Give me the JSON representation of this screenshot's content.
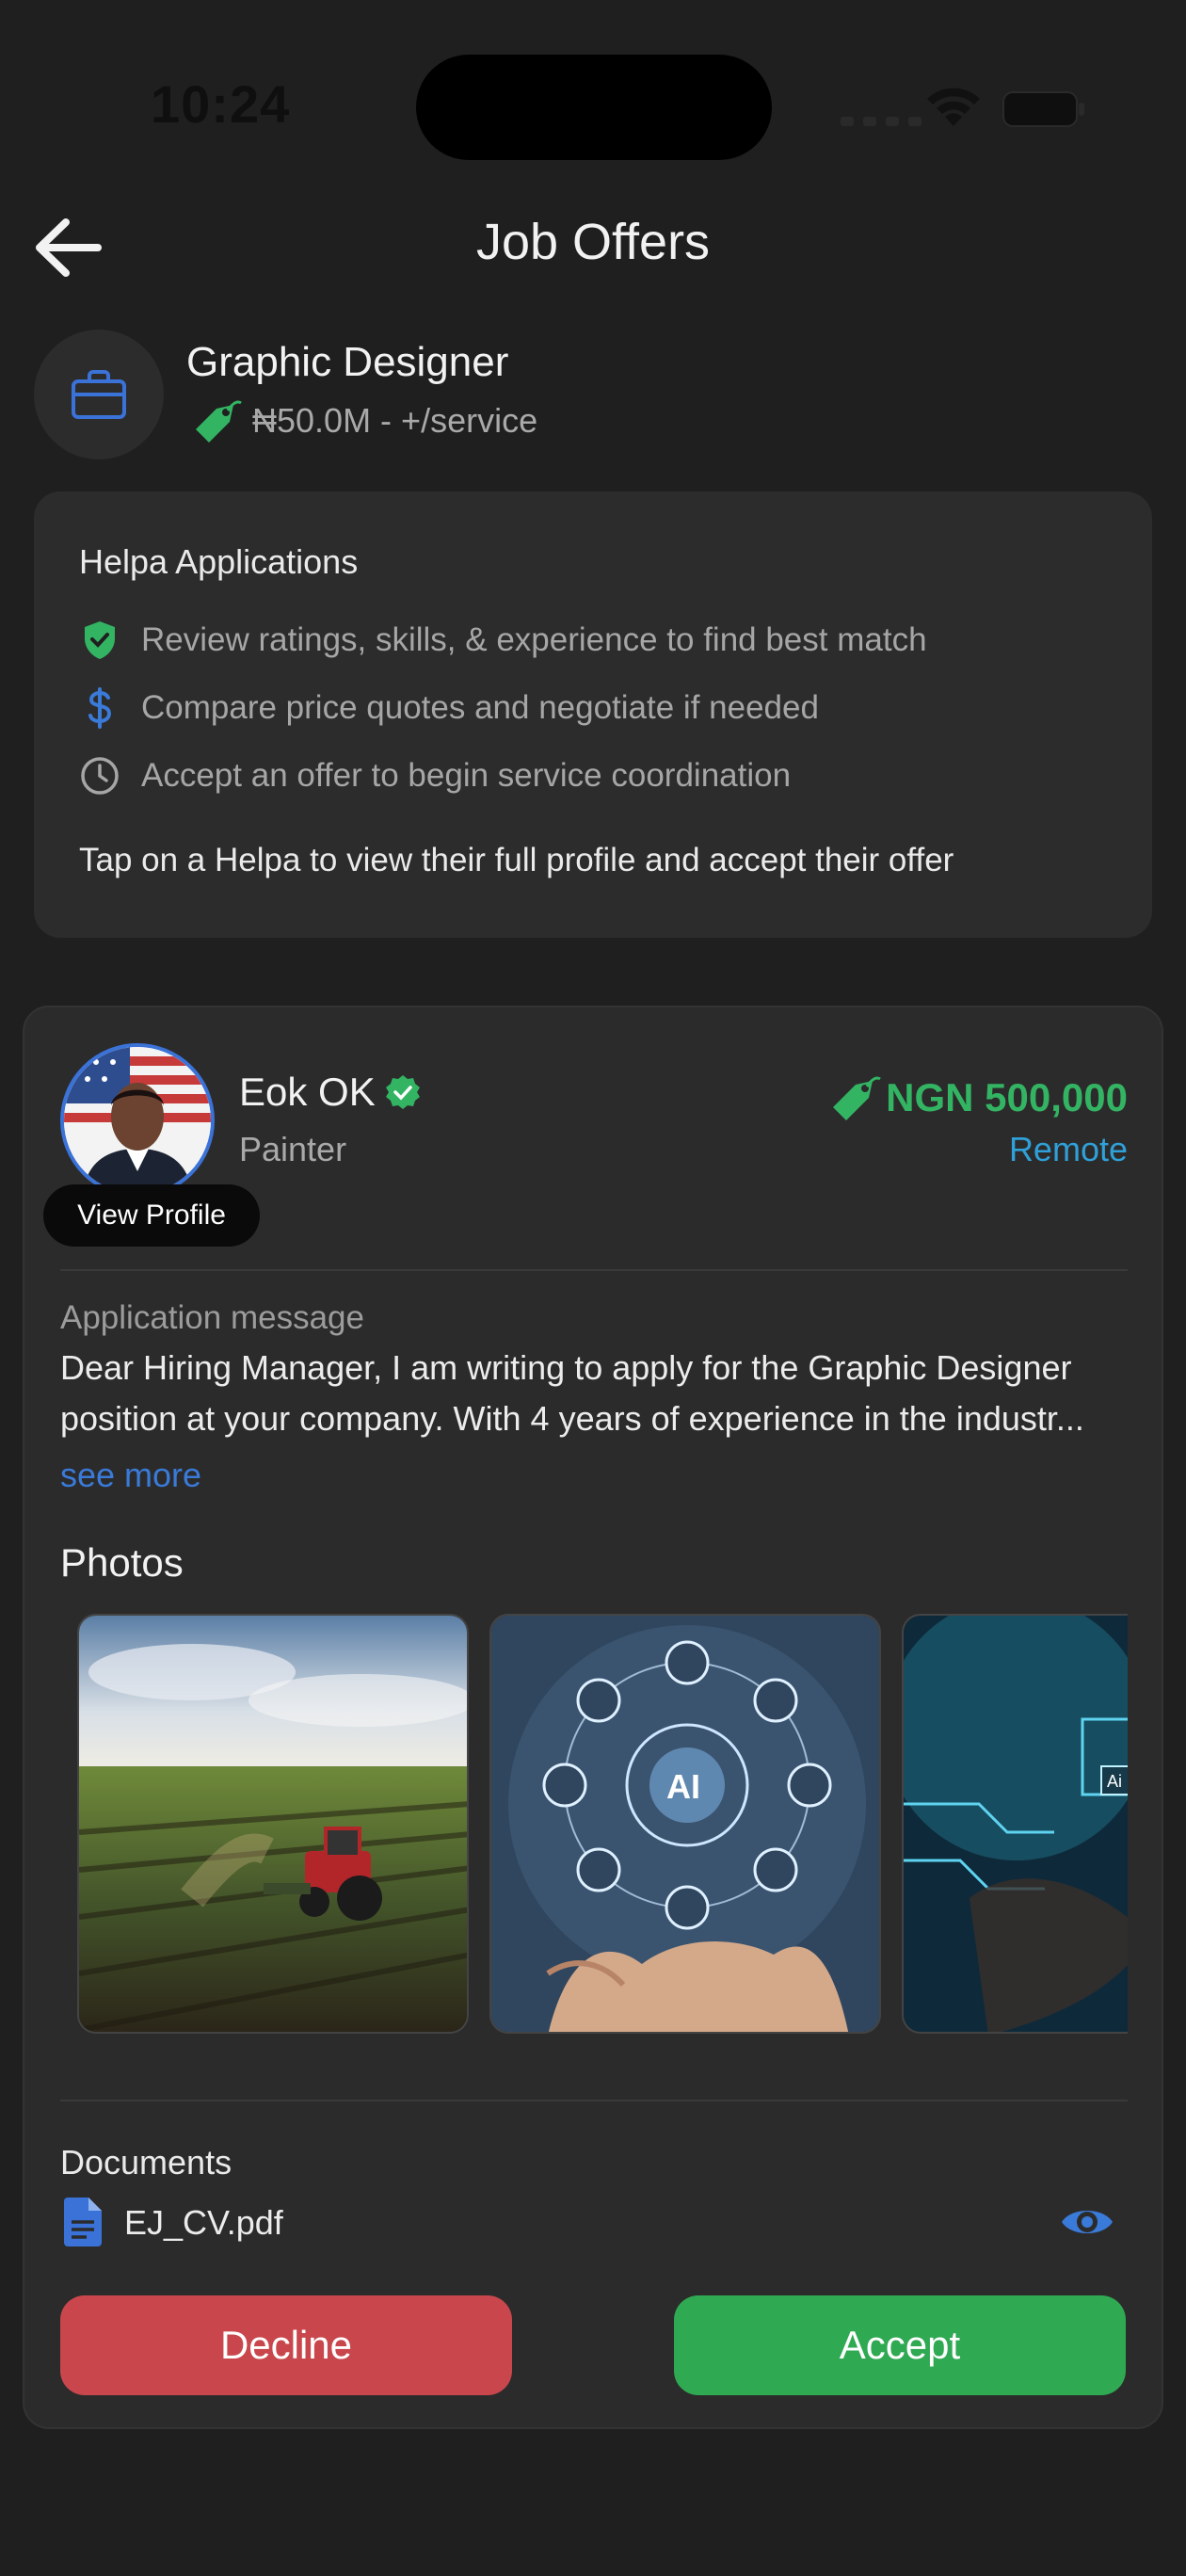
{
  "status_bar": {
    "time": "10:24"
  },
  "header": {
    "title": "Job Offers"
  },
  "job": {
    "title": "Graphic Designer",
    "price": "₦50.0M - +/service",
    "icon": "briefcase-icon"
  },
  "info": {
    "title": "Helpa Applications",
    "items": [
      {
        "icon": "shield-check-icon",
        "text": "Review ratings, skills, & experience to find best match"
      },
      {
        "icon": "dollar-icon",
        "text": "Compare price quotes and negotiate if needed"
      },
      {
        "icon": "clock-icon",
        "text": "Accept an offer to begin service coordination"
      }
    ],
    "footer": "Tap on a Helpa to view their full profile and accept their offer"
  },
  "applicant": {
    "name": "Eok OK",
    "role": "Painter",
    "view_profile_label": "View Profile",
    "price": "NGN 500,000",
    "location": "Remote",
    "message_label": "Application message",
    "message": "Dear Hiring Manager, I am writing to apply for the Graphic Designer position at your company. With 4 years of experience in the industr...",
    "see_more": "see more",
    "photos_title": "Photos",
    "photos": [
      "tractor-field-photo",
      "ai-hand-photo",
      "ai-chip-photo"
    ],
    "documents_title": "Documents",
    "document_name": "EJ_CV.pdf",
    "decline_label": "Decline",
    "accept_label": "Accept"
  },
  "colors": {
    "background": "#1f1f1f",
    "card": "#2c2c2c",
    "accent_green": "#33b463",
    "accent_blue": "#3a7ad8",
    "decline": "#c9474c",
    "accept": "#2fa952"
  }
}
